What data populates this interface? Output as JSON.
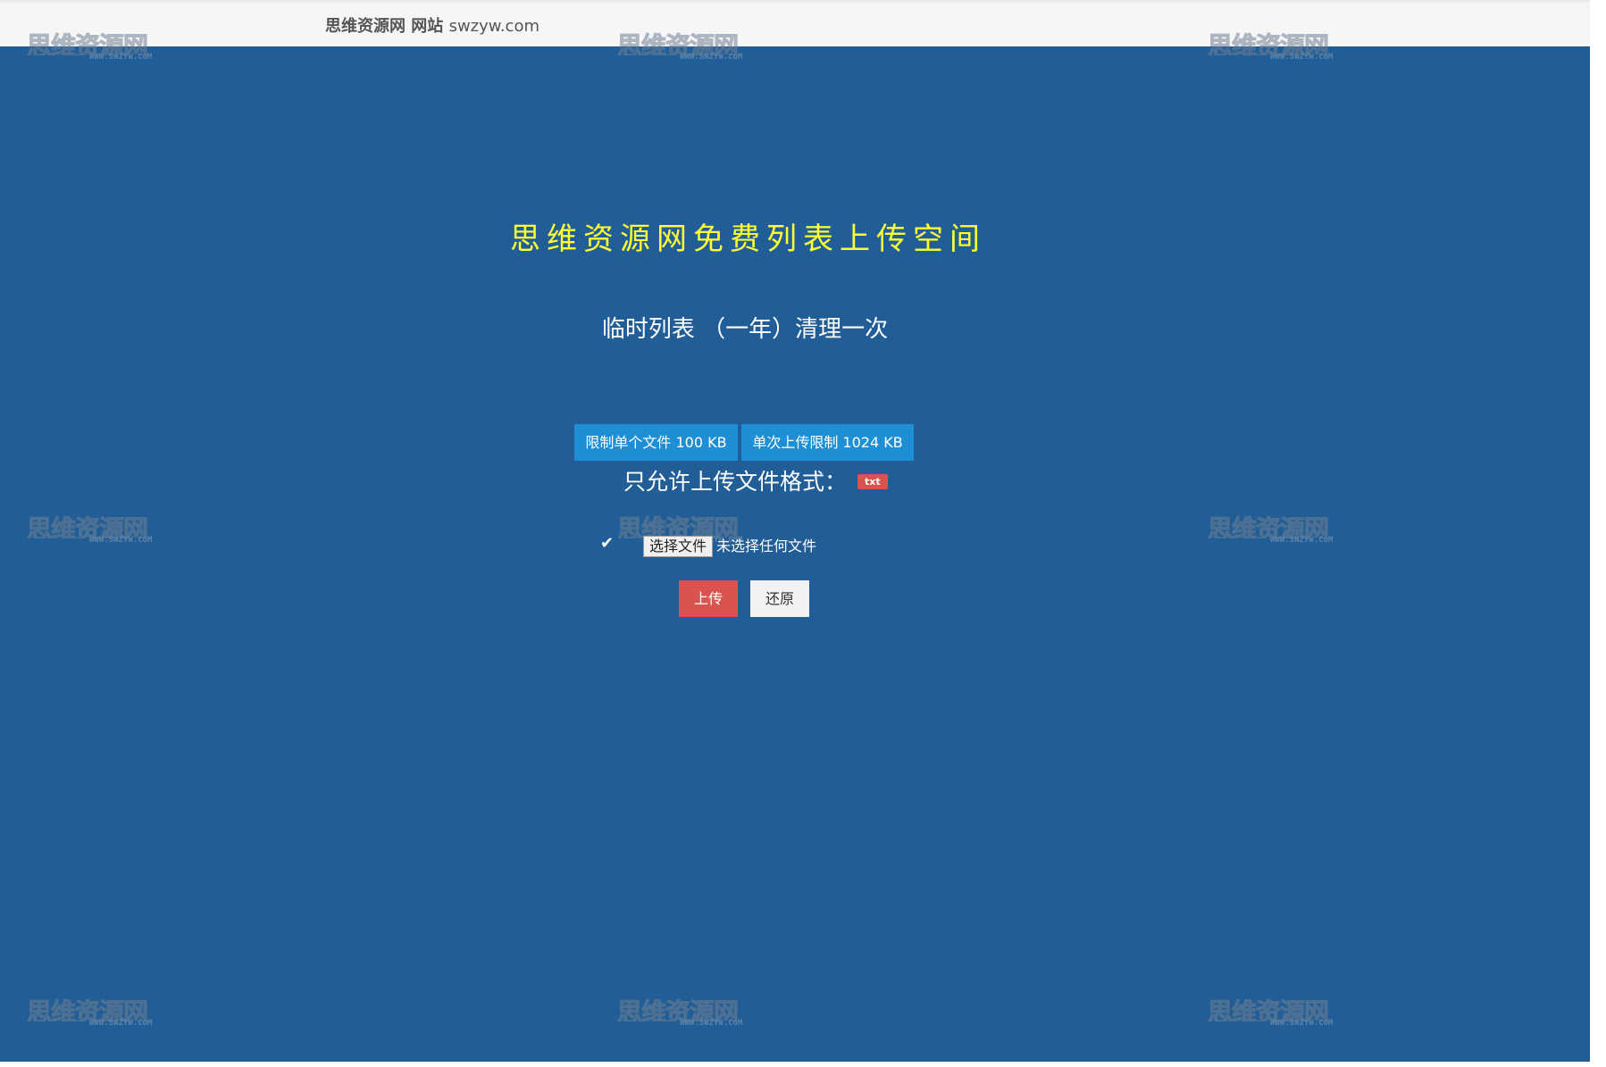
{
  "header": {
    "site_title": "思维资源网 网站",
    "site_url": "swzyw.com"
  },
  "main": {
    "title": "思维资源网免费列表上传空间",
    "subtitle": "临时列表 （一年）清理一次",
    "limits": [
      {
        "label": "限制单个文件 100 KB"
      },
      {
        "label": "单次上传限制 1024 KB"
      }
    ],
    "formats_label": "只允许上传文件格式：",
    "formats": [
      "txt"
    ],
    "file_input": {
      "button_label": "选择文件",
      "status": "未选择任何文件"
    },
    "upload_label": "上传",
    "reset_label": "还原"
  },
  "watermark": {
    "text": "思维资源网",
    "url": "WWW.SWZYW.CoM"
  },
  "colors": {
    "background": "#215d96",
    "title": "#ffff33",
    "limit_badge": "#1f8fd5",
    "upload_button": "#d9534f",
    "reset_button": "#f2f2f2"
  }
}
